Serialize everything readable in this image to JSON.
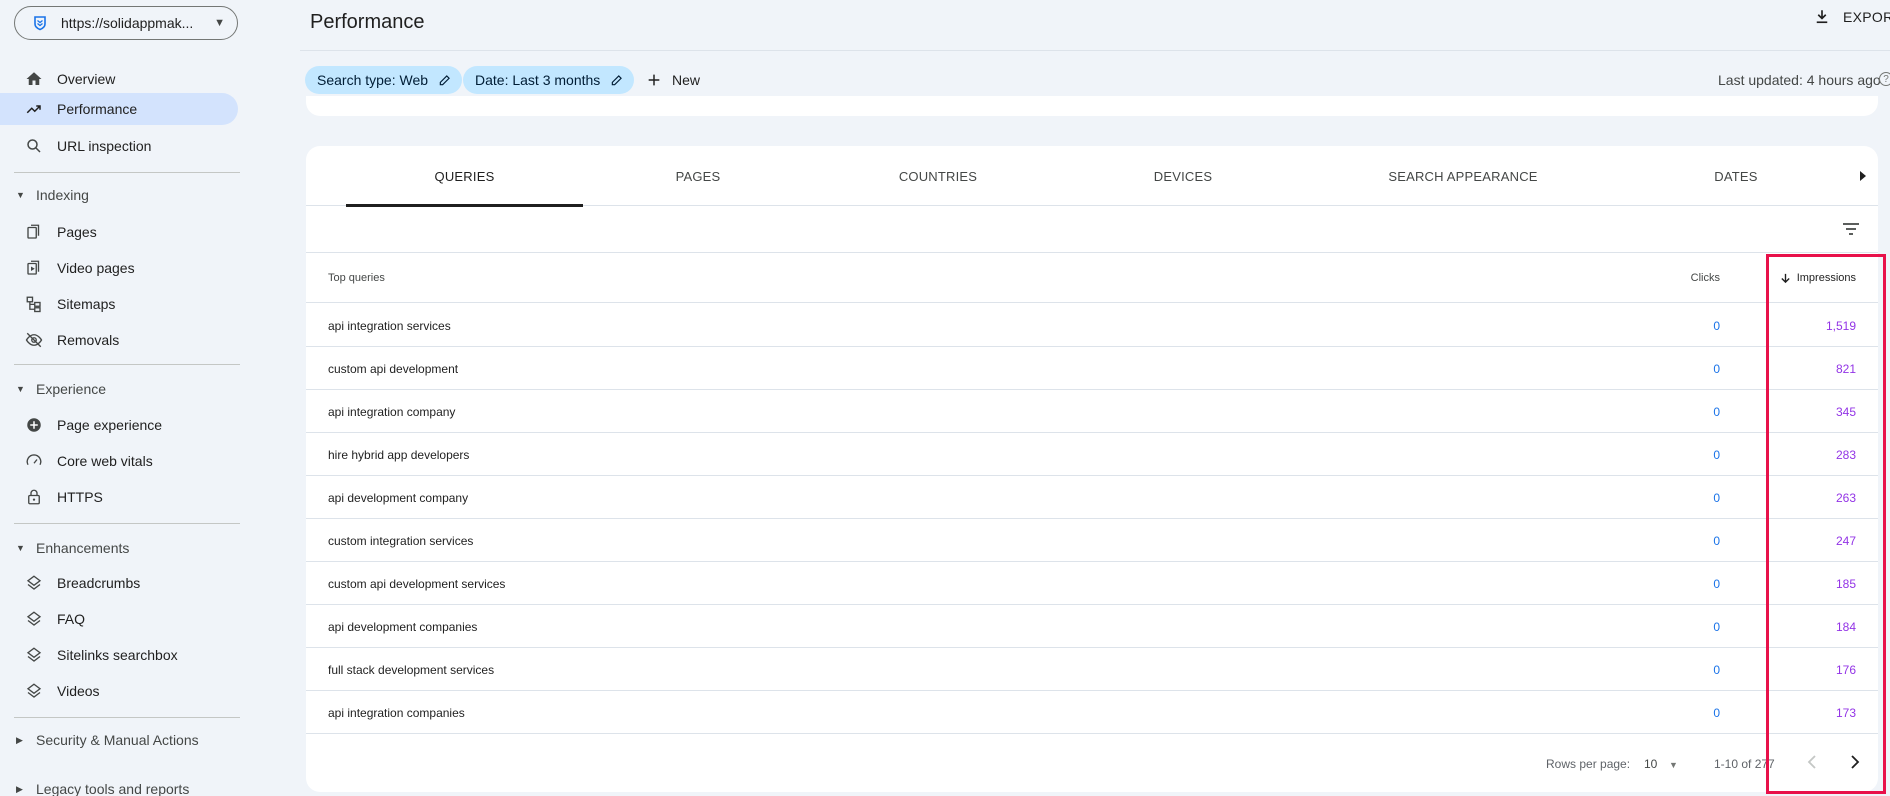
{
  "property": {
    "url": "https://solidappmak..."
  },
  "sidebar": {
    "main": [
      {
        "label": "Overview",
        "icon": "home-icon"
      },
      {
        "label": "Performance",
        "icon": "trending-up-icon",
        "active": true
      },
      {
        "label": "URL inspection",
        "icon": "search-icon"
      }
    ],
    "sections": [
      {
        "label": "Indexing",
        "items": [
          {
            "label": "Pages",
            "icon": "pages-icon"
          },
          {
            "label": "Video pages",
            "icon": "video-pages-icon"
          },
          {
            "label": "Sitemaps",
            "icon": "sitemap-icon"
          },
          {
            "label": "Removals",
            "icon": "visibility-off-icon"
          }
        ]
      },
      {
        "label": "Experience",
        "items": [
          {
            "label": "Page experience",
            "icon": "add-circle-icon"
          },
          {
            "label": "Core web vitals",
            "icon": "speedometer-icon"
          },
          {
            "label": "HTTPS",
            "icon": "lock-icon"
          }
        ]
      },
      {
        "label": "Enhancements",
        "items": [
          {
            "label": "Breadcrumbs",
            "icon": "layers-icon"
          },
          {
            "label": "FAQ",
            "icon": "layers-icon"
          },
          {
            "label": "Sitelinks searchbox",
            "icon": "layers-icon"
          },
          {
            "label": "Videos",
            "icon": "layers-icon"
          }
        ]
      }
    ],
    "collapsed_sections": [
      "Security & Manual Actions",
      "Legacy tools and reports"
    ]
  },
  "header": {
    "title": "Performance",
    "export_label": "EXPORT",
    "chips": [
      "Search type: Web",
      "Date: Last 3 months"
    ],
    "new_label": "New",
    "last_updated": "Last updated: 4 hours ago"
  },
  "tabs": [
    "QUERIES",
    "PAGES",
    "COUNTRIES",
    "DEVICES",
    "SEARCH APPEARANCE",
    "DATES"
  ],
  "active_tab": "QUERIES",
  "table": {
    "headers": {
      "query": "Top queries",
      "clicks": "Clicks",
      "impressions": "Impressions"
    },
    "sort": "impressions-desc",
    "rows": [
      {
        "query": "api integration services",
        "clicks": "0",
        "impressions": "1,519"
      },
      {
        "query": "custom api development",
        "clicks": "0",
        "impressions": "821"
      },
      {
        "query": "api integration company",
        "clicks": "0",
        "impressions": "345"
      },
      {
        "query": "hire hybrid app developers",
        "clicks": "0",
        "impressions": "283"
      },
      {
        "query": "api development company",
        "clicks": "0",
        "impressions": "263"
      },
      {
        "query": "custom integration services",
        "clicks": "0",
        "impressions": "247"
      },
      {
        "query": "custom api development services",
        "clicks": "0",
        "impressions": "185"
      },
      {
        "query": "api development companies",
        "clicks": "0",
        "impressions": "184"
      },
      {
        "query": "full stack development services",
        "clicks": "0",
        "impressions": "176"
      },
      {
        "query": "api integration companies",
        "clicks": "0",
        "impressions": "173"
      }
    ]
  },
  "pagination": {
    "rows_per_page_label": "Rows per page:",
    "rows_per_page": "10",
    "range": "1-10 of 277"
  },
  "colors": {
    "accent": "#d3e3fd",
    "chip": "#c2e7ff",
    "clicks": "#1a73e8",
    "impressions": "#9334e6",
    "highlight": "#e8114a"
  }
}
